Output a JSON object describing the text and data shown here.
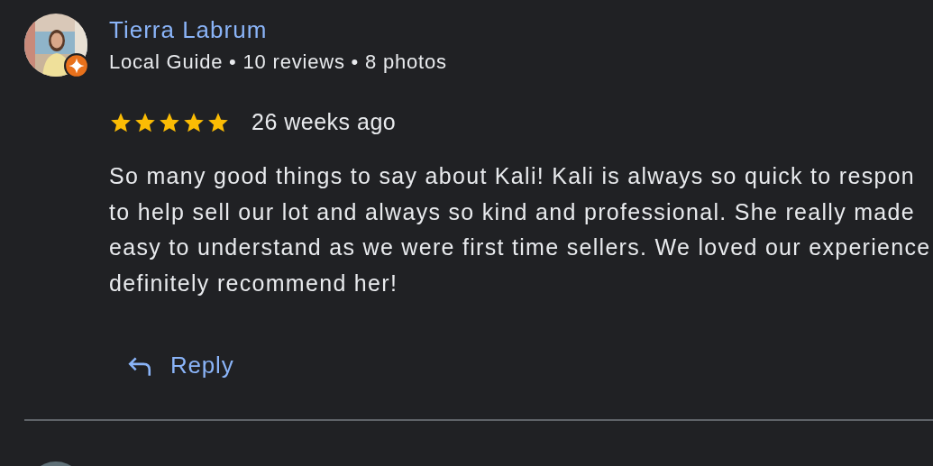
{
  "review": {
    "author": "Tierra Labrum",
    "meta": "Local Guide • 10 reviews • 8 photos",
    "local_guide": true,
    "stars": 5,
    "time": "26 weeks ago",
    "text_lines": [
      "So many good things to say about Kali! Kali is always so quick to respon",
      "to help sell our lot and always so kind and professional. She really made",
      "easy to understand as we were first time sellers. We loved our experience",
      "definitely recommend her!"
    ],
    "reply_label": "Reply"
  }
}
